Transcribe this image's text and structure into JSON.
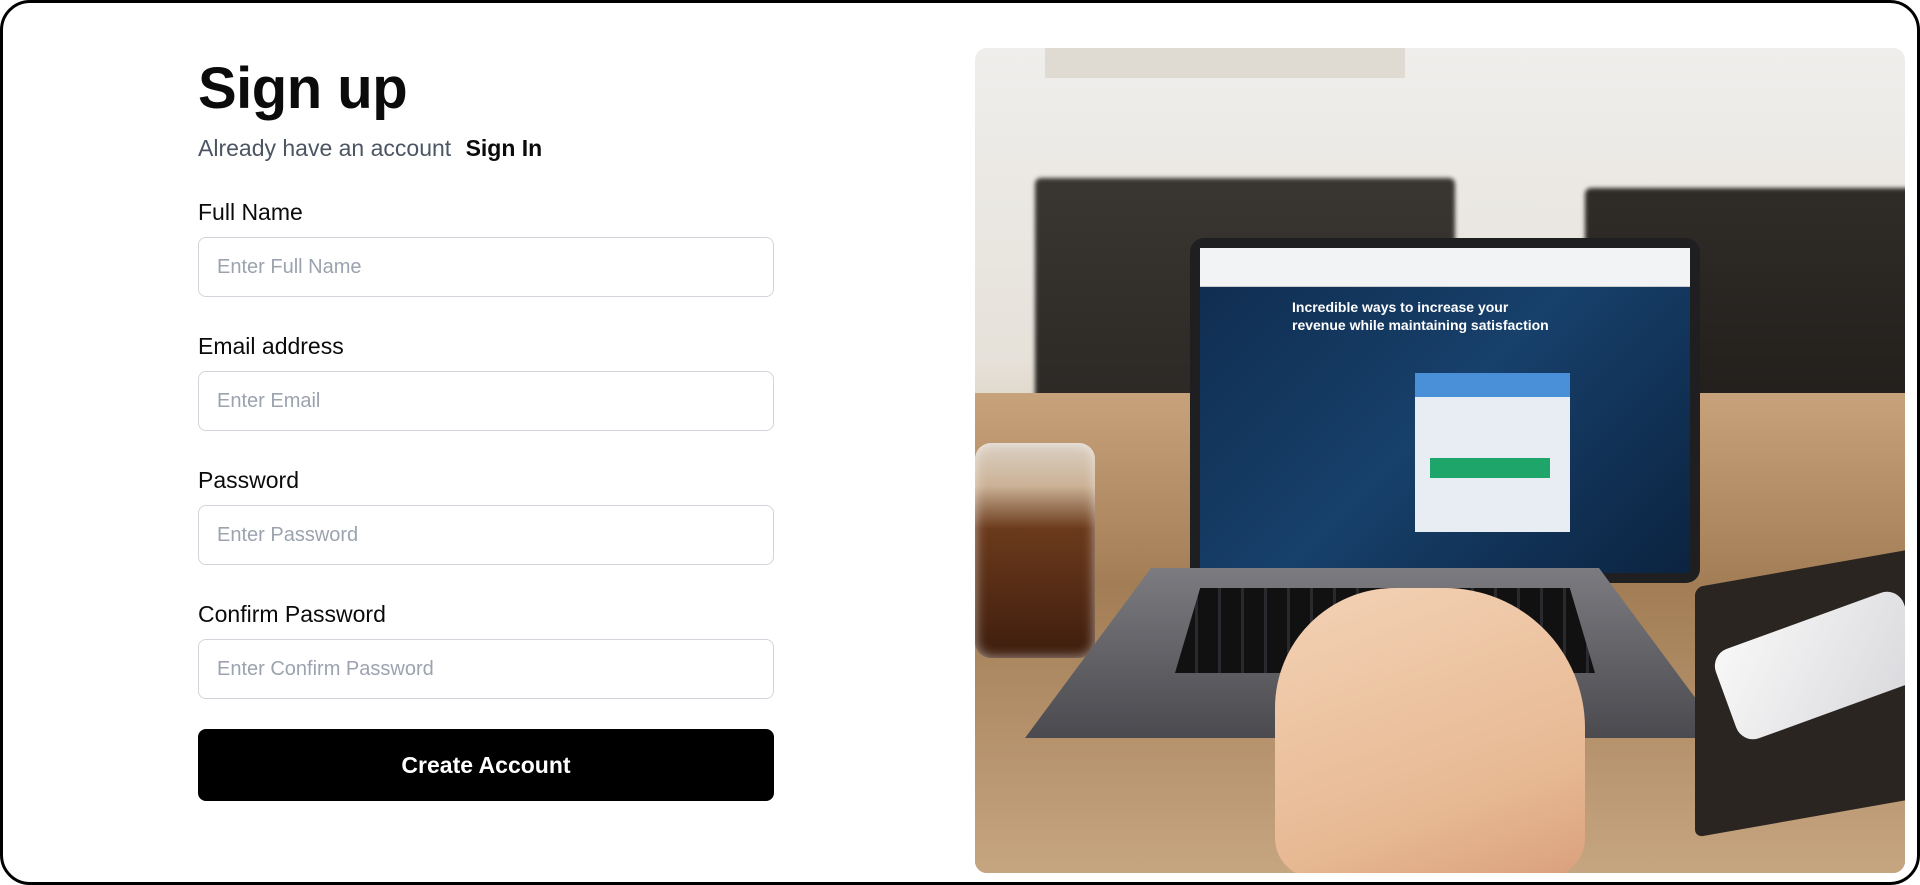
{
  "signup": {
    "title": "Sign up",
    "already_text": "Already have an account",
    "signin_link": "Sign In",
    "fields": {
      "full_name": {
        "label": "Full Name",
        "placeholder": "Enter Full Name"
      },
      "email": {
        "label": "Email address",
        "placeholder": "Enter Email"
      },
      "password": {
        "label": "Password",
        "placeholder": "Enter Password"
      },
      "confirm_password": {
        "label": "Confirm Password",
        "placeholder": "Enter Confirm Password"
      }
    },
    "submit_label": "Create Account"
  },
  "image": {
    "screen_headline": "Incredible ways to increase your revenue while maintaining satisfaction"
  }
}
